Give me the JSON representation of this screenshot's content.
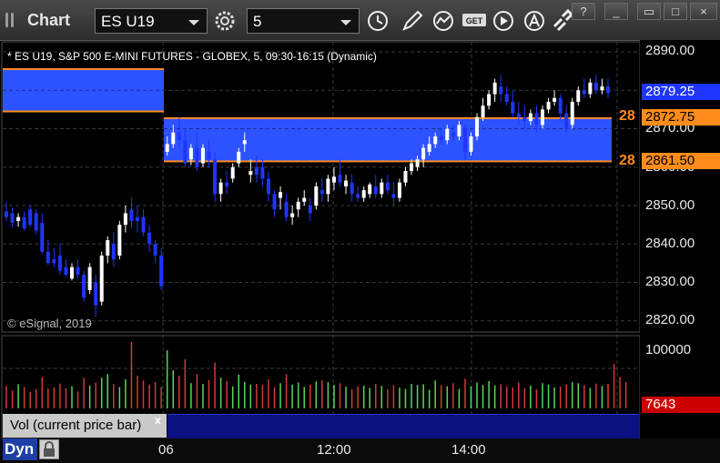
{
  "toolbar": {
    "title": "Chart",
    "symbol": "ES U19",
    "interval": "5"
  },
  "chart": {
    "header": "* ES U19, S&P 500 E-MINI FUTURES - GLOBEX, 5, 09:30-16:15 (Dynamic)",
    "watermark": "© eSignal, 2019",
    "price_labels": [
      "2890.00",
      "2870.00",
      "2860.00",
      "2850.00",
      "2840.00",
      "2830.00",
      "2820.00"
    ],
    "current_price": "2879.25",
    "zone_upper": "2872.75",
    "zone_lower": "2861.50",
    "zone_upper_trunc": "28",
    "zone_lower_trunc": "28",
    "zone_color": "#2d52ff",
    "zone_line_color": "#ff8c1a",
    "up_color": "#ffffff",
    "down_color": "#1f35ff"
  },
  "volume": {
    "axis_label": "100000",
    "current": "7643",
    "label": "Vol (current price bar)",
    "close_glyph": "x",
    "current_color": "#cc0000"
  },
  "time_axis": [
    "06",
    "12:00",
    "14:00"
  ],
  "footer": {
    "mode": "Dyn"
  },
  "chart_data": {
    "type": "candlestick",
    "ylim": [
      2817,
      2893
    ],
    "series": [
      {
        "o": 2848.5,
        "h": 2851,
        "c": 2847,
        "l": 2846
      },
      {
        "o": 2848,
        "h": 2849.5,
        "c": 2845.5,
        "l": 2844.5
      },
      {
        "o": 2846,
        "h": 2848,
        "c": 2847,
        "l": 2844.5
      },
      {
        "o": 2847,
        "h": 2848.5,
        "c": 2844,
        "l": 2843.5
      },
      {
        "o": 2849,
        "h": 2850,
        "c": 2845,
        "l": 2844.5
      },
      {
        "o": 2848,
        "h": 2849,
        "c": 2843.5,
        "l": 2842.5
      },
      {
        "o": 2845.5,
        "h": 2848,
        "c": 2838,
        "l": 2837.5
      },
      {
        "o": 2838,
        "h": 2841,
        "c": 2835,
        "l": 2834.5
      },
      {
        "o": 2836,
        "h": 2839,
        "c": 2835,
        "l": 2834
      },
      {
        "o": 2837,
        "h": 2840,
        "c": 2833,
        "l": 2832
      },
      {
        "o": 2834,
        "h": 2836,
        "c": 2832,
        "l": 2831.5
      },
      {
        "o": 2831,
        "h": 2835,
        "c": 2834,
        "l": 2830.5
      },
      {
        "o": 2834,
        "h": 2836,
        "c": 2832,
        "l": 2831
      },
      {
        "o": 2832,
        "h": 2833,
        "c": 2826,
        "l": 2825
      },
      {
        "o": 2828,
        "h": 2835,
        "c": 2834,
        "l": 2827
      },
      {
        "o": 2830,
        "h": 2832,
        "c": 2824,
        "l": 2821
      },
      {
        "o": 2825,
        "h": 2838,
        "c": 2837,
        "l": 2824
      },
      {
        "o": 2837,
        "h": 2842,
        "c": 2841,
        "l": 2835
      },
      {
        "o": 2840,
        "h": 2843,
        "c": 2836,
        "l": 2834
      },
      {
        "o": 2837,
        "h": 2846,
        "c": 2845,
        "l": 2836
      },
      {
        "o": 2845,
        "h": 2850,
        "c": 2848,
        "l": 2843
      },
      {
        "o": 2849,
        "h": 2852,
        "c": 2846,
        "l": 2844
      },
      {
        "o": 2847,
        "h": 2850,
        "c": 2846,
        "l": 2843
      },
      {
        "o": 2847,
        "h": 2849,
        "c": 2843,
        "l": 2842
      },
      {
        "o": 2843,
        "h": 2845,
        "c": 2840,
        "l": 2838
      },
      {
        "o": 2840,
        "h": 2841,
        "c": 2837,
        "l": 2835
      },
      {
        "o": 2837,
        "h": 2839,
        "c": 2829,
        "l": 2828
      },
      {
        "o": 2864,
        "h": 2868,
        "c": 2866,
        "l": 2863
      },
      {
        "o": 2866,
        "h": 2871,
        "c": 2869,
        "l": 2865
      },
      {
        "o": 2869,
        "h": 2873,
        "c": 2867,
        "l": 2865
      },
      {
        "o": 2867,
        "h": 2870,
        "c": 2861,
        "l": 2860
      },
      {
        "o": 2862,
        "h": 2866,
        "c": 2865,
        "l": 2860.5
      },
      {
        "o": 2865,
        "h": 2869,
        "c": 2860,
        "l": 2859
      },
      {
        "o": 2861,
        "h": 2866,
        "c": 2865,
        "l": 2860
      },
      {
        "o": 2864,
        "h": 2867,
        "c": 2862,
        "l": 2860
      },
      {
        "o": 2862,
        "h": 2864,
        "c": 2853,
        "l": 2851
      },
      {
        "o": 2853,
        "h": 2857,
        "c": 2856,
        "l": 2851
      },
      {
        "o": 2856,
        "h": 2859,
        "c": 2855,
        "l": 2853
      },
      {
        "o": 2857,
        "h": 2861,
        "c": 2860,
        "l": 2856
      },
      {
        "o": 2861,
        "h": 2865,
        "c": 2864,
        "l": 2860
      },
      {
        "o": 2866,
        "h": 2869,
        "c": 2867,
        "l": 2864
      },
      {
        "o": 2858,
        "h": 2862,
        "c": 2859,
        "l": 2856
      },
      {
        "o": 2860,
        "h": 2863,
        "c": 2858,
        "l": 2856
      },
      {
        "o": 2860,
        "h": 2862,
        "c": 2857,
        "l": 2855
      },
      {
        "o": 2857,
        "h": 2859,
        "c": 2853,
        "l": 2851
      },
      {
        "o": 2853,
        "h": 2854,
        "c": 2849,
        "l": 2847
      },
      {
        "o": 2852,
        "h": 2855,
        "c": 2853.5,
        "l": 2849
      },
      {
        "o": 2851,
        "h": 2853,
        "c": 2847,
        "l": 2846
      },
      {
        "o": 2847,
        "h": 2850,
        "c": 2848,
        "l": 2845
      },
      {
        "o": 2849,
        "h": 2852,
        "c": 2851,
        "l": 2847
      },
      {
        "o": 2851,
        "h": 2854,
        "c": 2852,
        "l": 2850
      },
      {
        "o": 2850,
        "h": 2852,
        "c": 2848,
        "l": 2846
      },
      {
        "o": 2850,
        "h": 2856,
        "c": 2855,
        "l": 2849
      },
      {
        "o": 2854,
        "h": 2857,
        "c": 2853,
        "l": 2851
      },
      {
        "o": 2853,
        "h": 2858,
        "c": 2857,
        "l": 2851
      },
      {
        "o": 2856,
        "h": 2860,
        "c": 2857.5,
        "l": 2854
      },
      {
        "o": 2858,
        "h": 2862,
        "c": 2856,
        "l": 2855
      },
      {
        "o": 2855,
        "h": 2858,
        "c": 2856.5,
        "l": 2853
      },
      {
        "o": 2856,
        "h": 2858,
        "c": 2853,
        "l": 2851
      },
      {
        "o": 2853,
        "h": 2855,
        "c": 2852,
        "l": 2851
      },
      {
        "o": 2852,
        "h": 2855,
        "c": 2854,
        "l": 2851
      },
      {
        "o": 2853,
        "h": 2856,
        "c": 2855.5,
        "l": 2852
      },
      {
        "o": 2855,
        "h": 2858,
        "c": 2853,
        "l": 2852
      },
      {
        "o": 2853,
        "h": 2857,
        "c": 2856,
        "l": 2852
      },
      {
        "o": 2856,
        "h": 2858,
        "c": 2854,
        "l": 2853
      },
      {
        "o": 2853,
        "h": 2856,
        "c": 2852,
        "l": 2850
      },
      {
        "o": 2852,
        "h": 2857,
        "c": 2856,
        "l": 2851
      },
      {
        "o": 2856,
        "h": 2860,
        "c": 2859,
        "l": 2855
      },
      {
        "o": 2859,
        "h": 2862,
        "c": 2861,
        "l": 2858
      },
      {
        "o": 2860,
        "h": 2863,
        "c": 2862,
        "l": 2859
      },
      {
        "o": 2862,
        "h": 2866,
        "c": 2865,
        "l": 2860
      },
      {
        "o": 2864,
        "h": 2868,
        "c": 2866,
        "l": 2863
      },
      {
        "o": 2866,
        "h": 2869,
        "c": 2868,
        "l": 2865
      },
      {
        "o": 2868,
        "h": 2870,
        "c": 2867,
        "l": 2866
      },
      {
        "o": 2867,
        "h": 2871,
        "c": 2870,
        "l": 2866
      },
      {
        "o": 2869,
        "h": 2871,
        "c": 2868,
        "l": 2867
      },
      {
        "o": 2868,
        "h": 2872,
        "c": 2871,
        "l": 2867
      },
      {
        "o": 2870,
        "h": 2871,
        "c": 2864,
        "l": 2862
      },
      {
        "o": 2864,
        "h": 2869,
        "c": 2868,
        "l": 2863
      },
      {
        "o": 2868,
        "h": 2874,
        "c": 2873,
        "l": 2867
      },
      {
        "o": 2873,
        "h": 2878,
        "c": 2876,
        "l": 2872
      },
      {
        "o": 2876,
        "h": 2880,
        "c": 2879,
        "l": 2875
      },
      {
        "o": 2879,
        "h": 2883,
        "c": 2882,
        "l": 2877
      },
      {
        "o": 2881,
        "h": 2884,
        "c": 2879,
        "l": 2877
      },
      {
        "o": 2879,
        "h": 2881,
        "c": 2877,
        "l": 2876
      },
      {
        "o": 2877,
        "h": 2880,
        "c": 2874,
        "l": 2873
      },
      {
        "o": 2874,
        "h": 2877,
        "c": 2873,
        "l": 2871
      },
      {
        "o": 2873,
        "h": 2876,
        "c": 2872,
        "l": 2870
      },
      {
        "o": 2872,
        "h": 2875,
        "c": 2874,
        "l": 2871
      },
      {
        "o": 2874,
        "h": 2876,
        "c": 2871,
        "l": 2869
      },
      {
        "o": 2871,
        "h": 2876,
        "c": 2875,
        "l": 2870
      },
      {
        "o": 2875,
        "h": 2878,
        "c": 2877,
        "l": 2874
      },
      {
        "o": 2877,
        "h": 2880,
        "c": 2878,
        "l": 2876
      },
      {
        "o": 2878,
        "h": 2879,
        "c": 2874,
        "l": 2872
      },
      {
        "o": 2874,
        "h": 2876,
        "c": 2870,
        "l": 2869
      },
      {
        "o": 2871,
        "h": 2878,
        "c": 2877,
        "l": 2870
      },
      {
        "o": 2877,
        "h": 2881,
        "c": 2880,
        "l": 2876
      },
      {
        "o": 2880,
        "h": 2883,
        "c": 2879,
        "l": 2878
      },
      {
        "o": 2879,
        "h": 2883,
        "c": 2882,
        "l": 2878
      },
      {
        "o": 2882,
        "h": 2884,
        "c": 2880,
        "l": 2879
      },
      {
        "o": 2880,
        "h": 2883,
        "c": 2881,
        "l": 2879
      },
      {
        "o": 2881,
        "h": 2883,
        "c": 2879.25,
        "l": 2878
      }
    ],
    "volume_values": [
      6500,
      5200,
      7000,
      6200,
      4800,
      5600,
      9000,
      5800,
      6100,
      7200,
      5900,
      6400,
      4900,
      8800,
      6600,
      7400,
      8900,
      9900,
      7100,
      6200,
      8400,
      19200,
      9400,
      8100,
      6900,
      7600,
      6200,
      16800,
      11000,
      9500,
      14200,
      7300,
      9900,
      7100,
      8200,
      13300,
      8900,
      7900,
      6400,
      9800,
      7700,
      6900,
      7100,
      6800,
      8400,
      6100,
      7300,
      9900,
      6900,
      7500,
      6200,
      6900,
      7800,
      8100,
      7600,
      6800,
      7300,
      6300,
      5500,
      6400,
      6600,
      5900,
      7100,
      6500,
      5500,
      6700,
      6000,
      5600,
      7100,
      6800,
      7000,
      5400,
      8100,
      6700,
      6400,
      7300,
      5600,
      8600,
      6400,
      7500,
      6800,
      7900,
      6700,
      7000,
      6300,
      6100,
      7500,
      5800,
      6600,
      5500,
      7300,
      6900,
      6100,
      6300,
      7000,
      7600,
      7300,
      6800,
      5900,
      7200,
      6500,
      7100,
      12900,
      9100,
      7643
    ]
  }
}
